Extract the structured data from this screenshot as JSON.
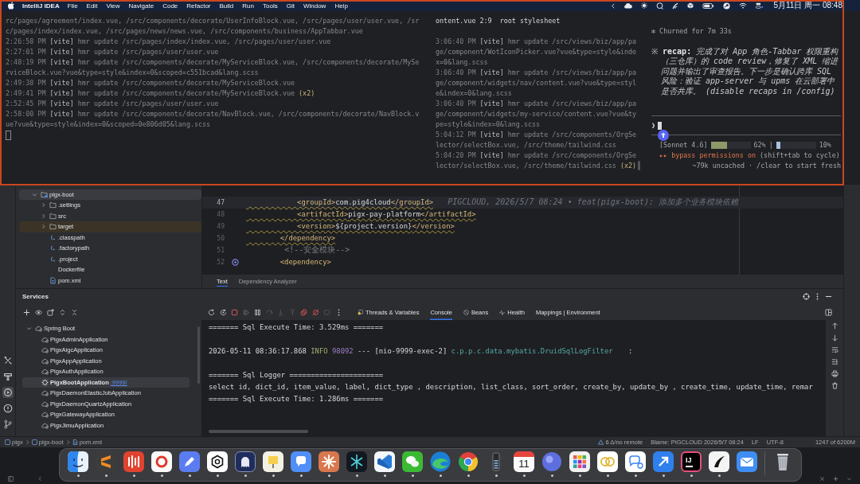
{
  "menu_bar": {
    "app": "IntelliJ IDEA",
    "menus": [
      "File",
      "Edit",
      "View",
      "Navigate",
      "Code",
      "Refactor",
      "Build",
      "Run",
      "Tools",
      "Git",
      "Window",
      "Help"
    ],
    "clock": "5月11日 周一 08:48"
  },
  "terminal": {
    "log_pane": {
      "entries": [
        {
          "text": "rc/pages/agreement/index.vue, /src/components/decorate/UserInfoBlock.vue, /src/pages/user/user.vue, /src/pages/index/index.vue, /src/pages/news/news.vue, /src/components/business/AppTabbar.vue"
        },
        {
          "time": "2:26:58 PM",
          "source": "[vite]",
          "text": "hmr update /src/pages/index/index.vue, /src/pages/user/user.vue"
        },
        {
          "time": "2:27:01 PM",
          "source": "[vite]",
          "text": "hmr update /src/pages/user/user.vue"
        },
        {
          "time": "2:48:19 PM",
          "source": "[vite]",
          "text": "hmr update /src/components/decorate/MyServiceBlock.vue, /src/components/decorate/MyServiceBlock.vue?vue&type=style&index=0&scoped=c551bcad&lang.scss"
        },
        {
          "time": "2:49:38 PM",
          "source": "[vite]",
          "text": "hmr update /src/components/decorate/MyServiceBlock.vue"
        },
        {
          "time": "2:49:41 PM",
          "source": "[vite]",
          "text": "hmr update /src/components/decorate/MyServiceBlock.vue",
          "count": "(x2)"
        },
        {
          "time": "2:52:45 PM",
          "source": "[vite]",
          "text": "hmr update /src/pages/user/user.vue"
        },
        {
          "time": "2:58:00 PM",
          "source": "[vite]",
          "text": "hmr update /src/components/decorate/NavBlock.vue, /src/components/decorate/NavBlock.vue?vue&type=style&index=0&scoped=0e806d05&lang.scss"
        }
      ]
    },
    "mid_pane": {
      "header": "ontent.vue 2:9  root stylesheet",
      "entries": [
        {
          "time": "3:06:40 PM",
          "source": "[vite]",
          "text": "hmr update /src/views/biz/app/page/component/WotIconPicker.vue?vue&type=style&index=0&lang.scss"
        },
        {
          "time": "3:06:40 PM",
          "source": "[vite]",
          "text": "hmr update /src/views/biz/app/page/component/widgets/nav/content.vue?vue&type=style&index=0&lang.scss"
        },
        {
          "time": "3:06:40 PM",
          "source": "[vite]",
          "text": "hmr update /src/views/biz/app/page/component/widgets/my-service/content.vue?vue&type=style&index=0&lang.scss"
        },
        {
          "time": "5:04:12 PM",
          "source": "[vite]",
          "text": "hmr update /src/components/OrgSelector/selectBox.vue, /src/theme/tailwind.css"
        },
        {
          "time": "5:04:20 PM",
          "source": "[vite]",
          "text": "hmr update /src/components/OrgSelector/selectBox.vue, /src/theme/tailwind.css",
          "count": "(x2)"
        }
      ]
    },
    "agent_pane": {
      "churned": "✻ Churned for 7m 33s",
      "recap": "※ **recap:** *完成了对 App 角色-Tabbar 权限重构（三仓库）的 code review，修复了 XML 缩进问题并输出了审查报告。下一步是确认跨库 SQL 风险：验证 app-server 与 upms 在云部署中是否共库。 (disable recaps in /config)*",
      "prompt": "❯",
      "model": "[Sonnet 4.6]",
      "separator": "|",
      "meters": [
        {
          "level": 0.4,
          "color": "#8b9a68",
          "reading": "62%"
        },
        {
          "level": 0.1,
          "color": "#a9c1df",
          "reading": "10%"
        }
      ],
      "mode": {
        "marker": "▸▸",
        "label": "bypass permissions on",
        "hint": "(shift+tab to cycle)"
      },
      "cache_note": "~79k uncached · /clear to start fresh"
    }
  },
  "tool_strip": [
    {
      "kind": "tools",
      "selected": false
    },
    {
      "kind": "build",
      "selected": false
    },
    {
      "kind": "services",
      "selected": true
    },
    {
      "kind": "problems",
      "selected": false
    },
    {
      "kind": "git",
      "selected": false
    }
  ],
  "project_tree": {
    "items": [
      {
        "name": "pigx-boot",
        "kind": "module",
        "expanded": true,
        "selected": true,
        "children": [
          {
            "name": ".settings",
            "kind": "folder",
            "expanded": false,
            "selected": false,
            "highlighted": false
          },
          {
            "name": "src",
            "kind": "folder",
            "expanded": false,
            "selected": false,
            "highlighted": false
          },
          {
            "name": "target",
            "kind": "folder",
            "expanded": false,
            "selected": false,
            "highlighted": true
          },
          {
            "name": ".classpath",
            "kind": "file",
            "expanded": false,
            "selected": false,
            "highlighted": false
          },
          {
            "name": ".factorypath",
            "kind": "file",
            "expanded": false,
            "selected": false,
            "highlighted": false
          },
          {
            "name": ".project",
            "kind": "file",
            "expanded": false,
            "selected": false,
            "highlighted": false
          },
          {
            "name": "Dockerfile",
            "kind": "plain",
            "expanded": false,
            "selected": false,
            "highlighted": false
          },
          {
            "name": "pom.xml",
            "kind": "maven",
            "expanded": false,
            "selected": false,
            "highlighted": false
          }
        ]
      }
    ]
  },
  "editor": {
    "lines": [
      {
        "number": "47",
        "current": true,
        "warning": true,
        "marker": false,
        "parts": [
          {
            "kind": "tag",
            "text": "            <groupId>"
          },
          {
            "kind": "text",
            "text": "com.pig4cloud"
          },
          {
            "kind": "tag",
            "text": "</groupId>"
          }
        ],
        "blame": "PIGCLOUD, 2026/5/7 08:24 • feat(pigx-boot): 添加多个业务模块依赖"
      },
      {
        "number": "48",
        "current": false,
        "warning": true,
        "marker": false,
        "parts": [
          {
            "kind": "tag",
            "text": "            <artifactId>"
          },
          {
            "kind": "text",
            "text": "pigx-pay-platform"
          },
          {
            "kind": "tag",
            "text": "</artifactId>"
          }
        ]
      },
      {
        "number": "49",
        "current": false,
        "warning": true,
        "marker": false,
        "parts": [
          {
            "kind": "tag",
            "text": "            <version>"
          },
          {
            "kind": "text",
            "text": "${project.version}"
          },
          {
            "kind": "tag",
            "text": "</version>"
          }
        ]
      },
      {
        "number": "50",
        "current": false,
        "warning": true,
        "marker": false,
        "parts": [
          {
            "kind": "tag",
            "text": "        </dependency>"
          }
        ]
      },
      {
        "number": "51",
        "current": false,
        "warning": false,
        "marker": false,
        "parts": [
          {
            "kind": "comment",
            "text": "        <!--安全模块-->"
          }
        ]
      },
      {
        "number": "52",
        "current": false,
        "warning": false,
        "marker": true,
        "parts": [
          {
            "kind": "tag",
            "text": "        <dependency>"
          }
        ]
      }
    ],
    "tabs": [
      {
        "label": "Text",
        "selected": true
      },
      {
        "label": "Dependency Analyzer",
        "selected": false
      }
    ]
  },
  "services": {
    "title": "Services",
    "tree": [
      {
        "name": "Spring Boot",
        "running": false,
        "selected": false,
        "expanded": true,
        "children": [
          {
            "name": "PigxAdminApplication",
            "running": false,
            "selected": false
          },
          {
            "name": "PigxAigcApplication",
            "running": false,
            "selected": false
          },
          {
            "name": "PigxAppApplication",
            "running": false,
            "selected": false
          },
          {
            "name": "PigxAuthApplication",
            "running": false,
            "selected": false
          },
          {
            "name": "PigxBootApplication",
            "running": true,
            "selected": true,
            "link": ":9999/"
          },
          {
            "name": "PigxDaemonElasticJobApplication",
            "running": false,
            "selected": false
          },
          {
            "name": "PigxDaemonQuartzApplication",
            "running": false,
            "selected": false
          },
          {
            "name": "PigxGatewayApplication",
            "running": false,
            "selected": false
          },
          {
            "name": "PigxJimuApplication",
            "running": false,
            "selected": false
          }
        ]
      }
    ]
  },
  "console": {
    "tabs": [
      {
        "kind": "threads",
        "label": "Threads & Variables",
        "selected": false
      },
      {
        "kind": "console",
        "label": "Console",
        "selected": true
      },
      {
        "kind": "beans",
        "label": "Beans",
        "selected": false
      },
      {
        "kind": "health",
        "label": "Health",
        "selected": false
      },
      {
        "kind": "mappings",
        "label": "Mappings | Environment",
        "selected": false
      }
    ],
    "lines": [
      {
        "kind": "plain",
        "text": "======= Sql Execute Time: 3.529ms ======="
      },
      {
        "kind": "blank"
      },
      {
        "kind": "log",
        "timestamp": "2026-05-11 08:36:17.868",
        "level": "INFO",
        "pid": "98092",
        "thread": "--- [nio-9999-exec-2]",
        "logger": "c.p.p.c.data.mybatis.DruidSqlLogFilter",
        "tail": ":"
      },
      {
        "kind": "blank"
      },
      {
        "kind": "plain",
        "text": "======= Sql Logger ======================"
      },
      {
        "kind": "plain",
        "text": "select id, dict_id, item_value, label, dict_type , description, list_class, sort_order, create_by, update_by , create_time, update_time, remar"
      },
      {
        "kind": "plain",
        "text": "======= Sql Execute Time: 1.286ms ======="
      }
    ]
  },
  "status_bar": {
    "breadcrumbs": [
      {
        "kind": "module",
        "label": "pigx"
      },
      {
        "kind": "module",
        "label": "pigx-boot"
      },
      {
        "kind": "maven",
        "label": "pom.xml"
      }
    ],
    "vcs": "6 Δ/no remote",
    "blame": "Blame: PIGCLOUD 2026/5/7 08:24",
    "line_separator": "LF",
    "encoding": "UTF-8",
    "memory": "1247 of 6200M"
  },
  "dock": {
    "apps": [
      {
        "kind": "face",
        "running": true
      },
      {
        "kind": "stripes",
        "running": true
      },
      {
        "kind": "bars",
        "running": true
      },
      {
        "kind": "ring",
        "running": true
      },
      {
        "kind": "pen",
        "running": true
      },
      {
        "kind": "knot",
        "running": true
      },
      {
        "kind": "ghost",
        "running": true
      },
      {
        "kind": "note",
        "running": true
      },
      {
        "kind": "chat",
        "running": true
      },
      {
        "kind": "asterisk",
        "running": true
      },
      {
        "kind": "star",
        "running": true
      },
      {
        "kind": "ribbon",
        "running": true
      },
      {
        "kind": "bubbles",
        "running": true
      },
      {
        "kind": "swirl",
        "running": true
      },
      {
        "kind": "wheel",
        "running": true
      },
      {
        "kind": "meter",
        "running": true
      },
      {
        "kind": "calendar",
        "label": "11",
        "running": true
      },
      {
        "kind": "orb",
        "running": true
      },
      {
        "kind": "grid",
        "running": true
      },
      {
        "kind": "rings",
        "running": true
      },
      {
        "kind": "speech",
        "running": true
      },
      {
        "kind": "arrow",
        "running": true
      },
      {
        "kind": "letters",
        "label": "IJ",
        "running": true
      },
      {
        "kind": "swoosh",
        "running": true
      },
      {
        "kind": "envelope",
        "running": false
      }
    ]
  }
}
